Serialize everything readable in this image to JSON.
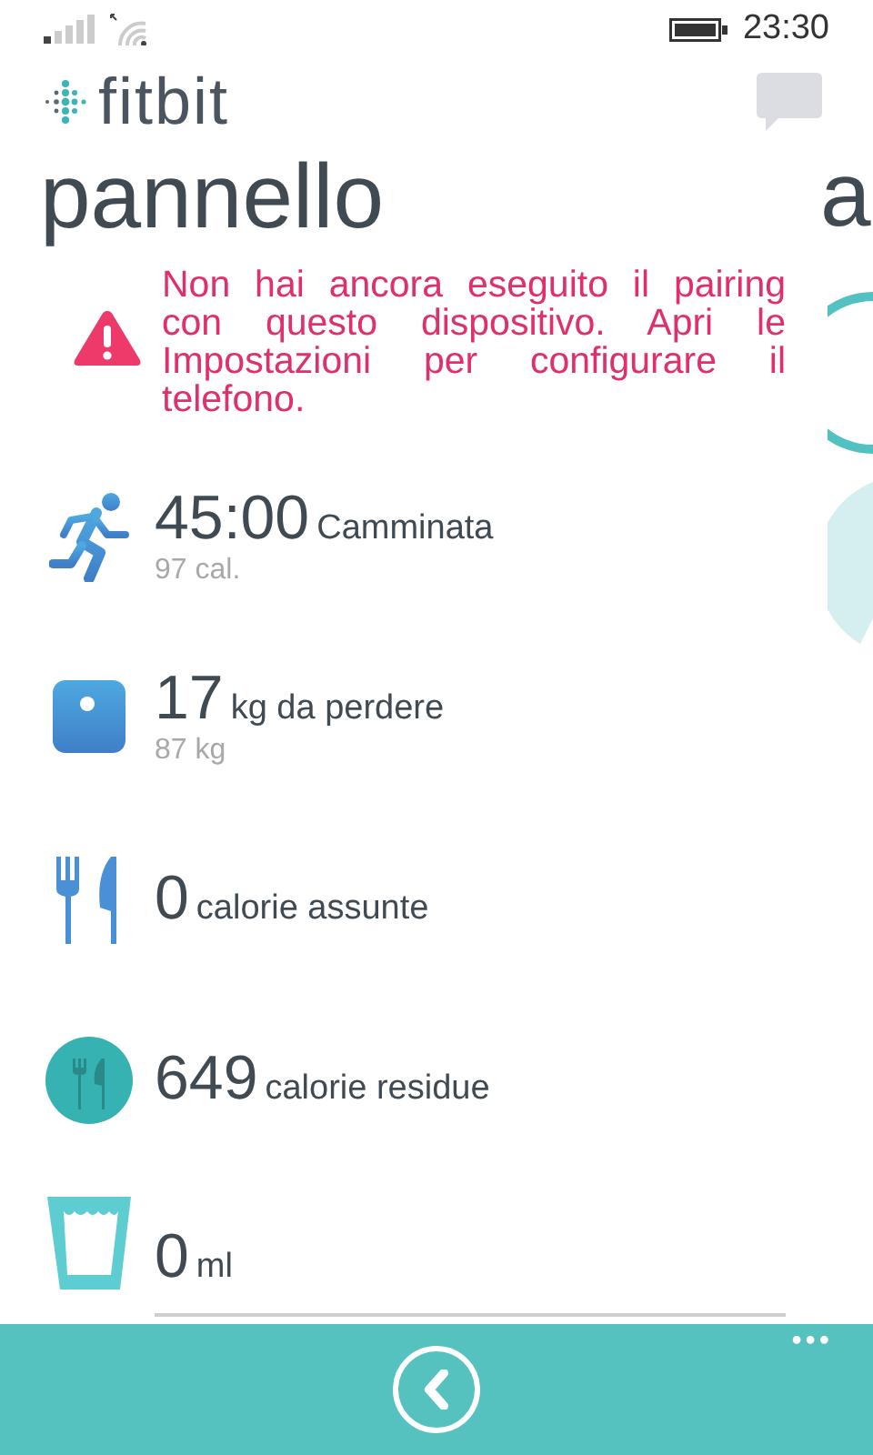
{
  "status_bar": {
    "time": "23:30"
  },
  "app": {
    "logo": "fitbit"
  },
  "pivot": {
    "title": "pannello",
    "next_title": "a"
  },
  "warning": {
    "text": "Non hai ancora eseguito il pairing con questo dispositivo. Apri le Impostazioni per configurare il telefono."
  },
  "rows": [
    {
      "kind": "walk",
      "value": "45:00",
      "label": "Camminata",
      "sub": "97 cal."
    },
    {
      "kind": "scale",
      "value": "17",
      "label": "kg da perdere",
      "sub": "87 kg"
    },
    {
      "kind": "food",
      "value": "0",
      "label": "calorie assunte"
    },
    {
      "kind": "remaining",
      "value": "649",
      "label": "calorie residue"
    },
    {
      "kind": "water",
      "value": "0",
      "label": "ml"
    }
  ],
  "app_bar": {
    "more": "•••"
  }
}
